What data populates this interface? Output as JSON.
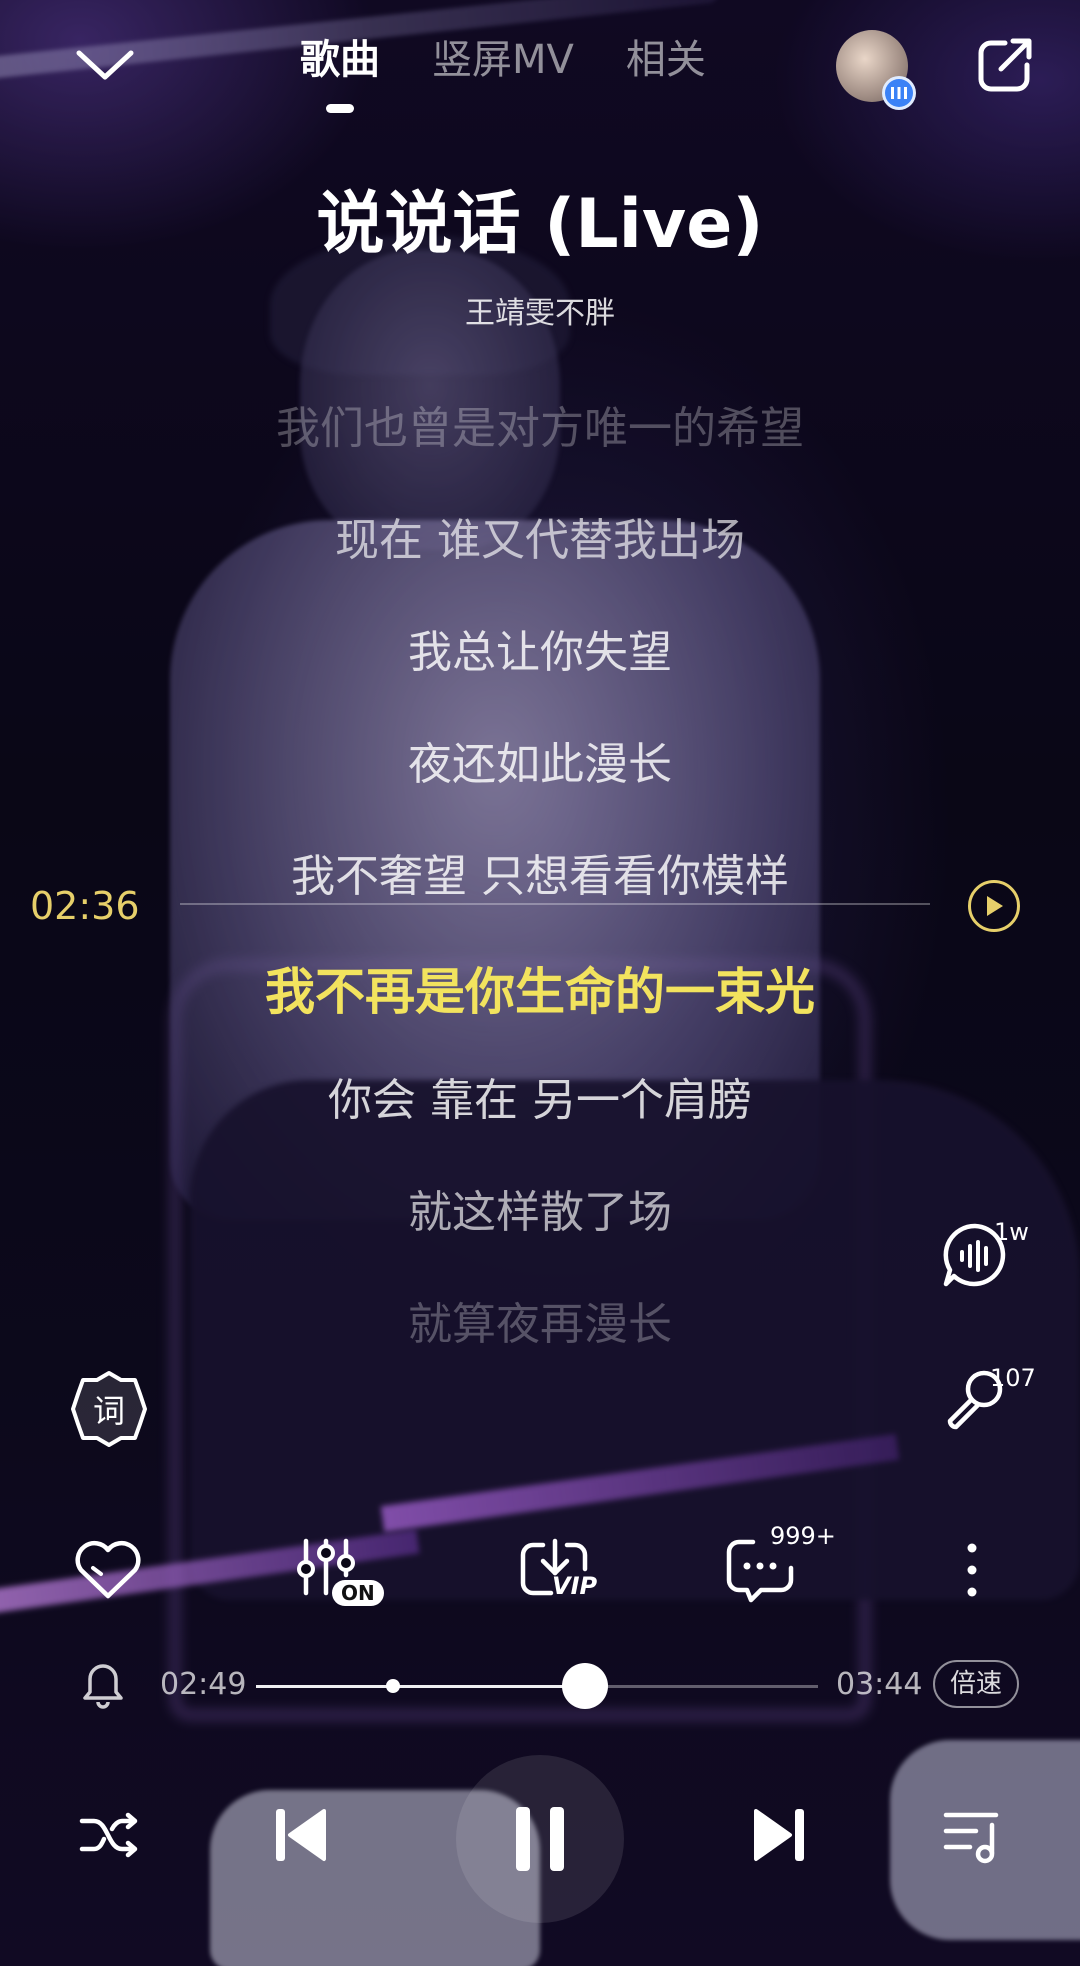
{
  "topbar": {
    "tabs": [
      {
        "label": "歌曲",
        "active": true
      },
      {
        "label": "竖屏MV",
        "active": false
      },
      {
        "label": "相关",
        "active": false
      }
    ],
    "back_icon": "chevron-down-icon",
    "share_icon": "share-icon",
    "avatar_badge_icon": "audio-bars-icon"
  },
  "song": {
    "title": "说说话 (Live)",
    "artist": "王靖雯不胖"
  },
  "lyrics": {
    "lines": [
      "我们也曾是对方唯一的希望",
      "现在 谁又代替我出场",
      "我总让你失望",
      "夜还如此漫长",
      "我不奢望 只想看看你模样",
      "我不再是你生命的一束光",
      "你会 靠在 另一个肩膀",
      "就这样散了场",
      "就算夜再漫长"
    ],
    "current_index": 5,
    "scrub_time": "02:36",
    "current_color": "#f2e35e"
  },
  "side": {
    "voice_count": "1w",
    "mic_count": "107",
    "lyric_mode_label": "词"
  },
  "actions": {
    "eq_label": "ON",
    "download_label": "VIP",
    "comment_count": "999+"
  },
  "progress": {
    "current": "02:49",
    "total": "03:44",
    "fraction": 0.585,
    "marker_fraction": 0.244,
    "speed_label": "倍速"
  }
}
